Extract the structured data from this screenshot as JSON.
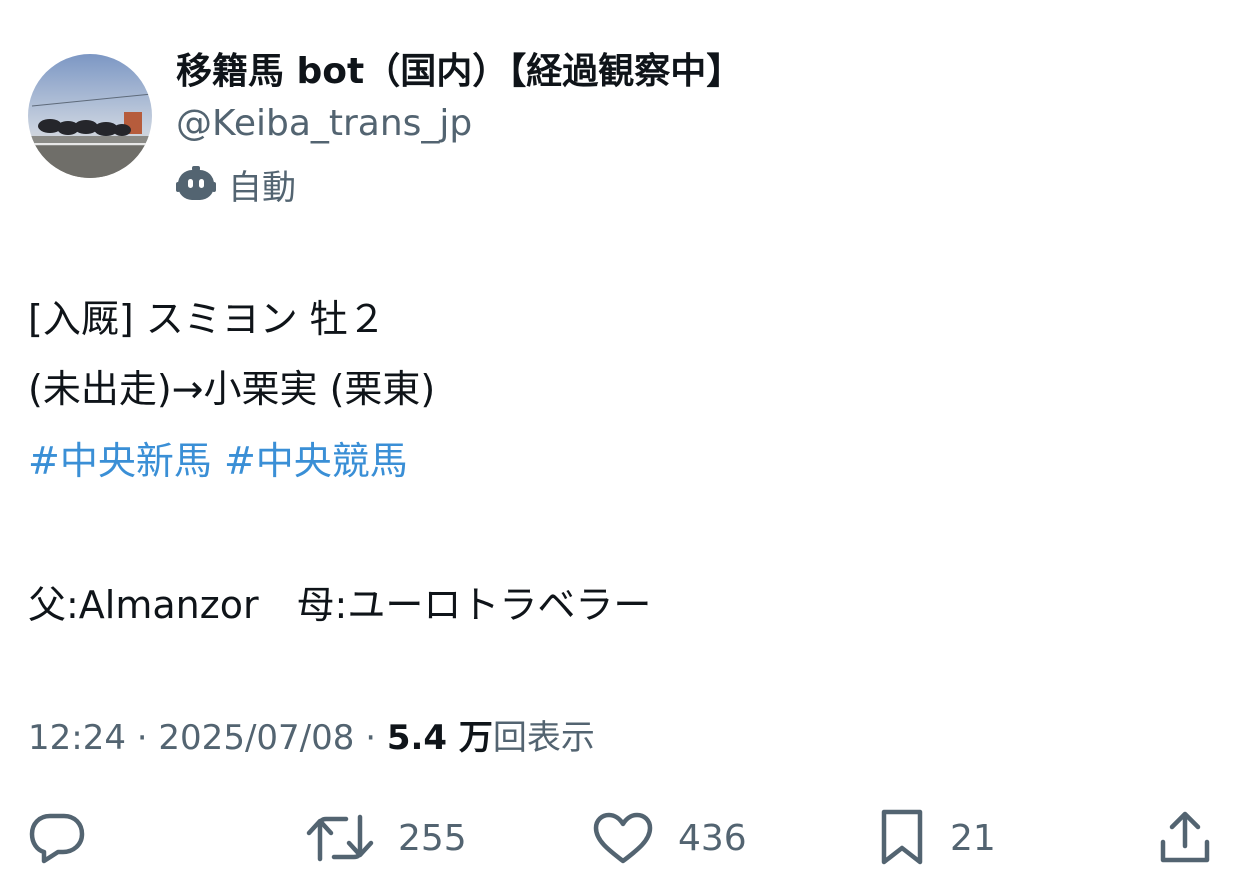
{
  "author": {
    "display_name": "移籍馬 bot（国内）【経過観察中】",
    "handle": "@Keiba_trans_jp",
    "automated_label": "自動",
    "avatar_icon": "profile-photo-horses-at-track"
  },
  "tweet": {
    "line1": "[入厩] スミヨン 牡２",
    "line2": "(未出走)→小栗実 (栗東)",
    "hashtags": [
      "#中央新馬",
      "#中央競馬"
    ],
    "line4": "父:Almanzor　母:ユーロトラベラー"
  },
  "meta": {
    "time": "12:24",
    "date": "2025/07/08",
    "separator": "·",
    "views_count": "5.4 万",
    "views_label": "回表示"
  },
  "actions": {
    "reply_icon": "reply-icon",
    "retweet_count": "255",
    "like_count": "436",
    "bookmark_count": "21",
    "share_icon": "share-icon"
  },
  "colors": {
    "text": "#0f1419",
    "secondary": "#536471",
    "hashtag": "#3a8fd6"
  }
}
